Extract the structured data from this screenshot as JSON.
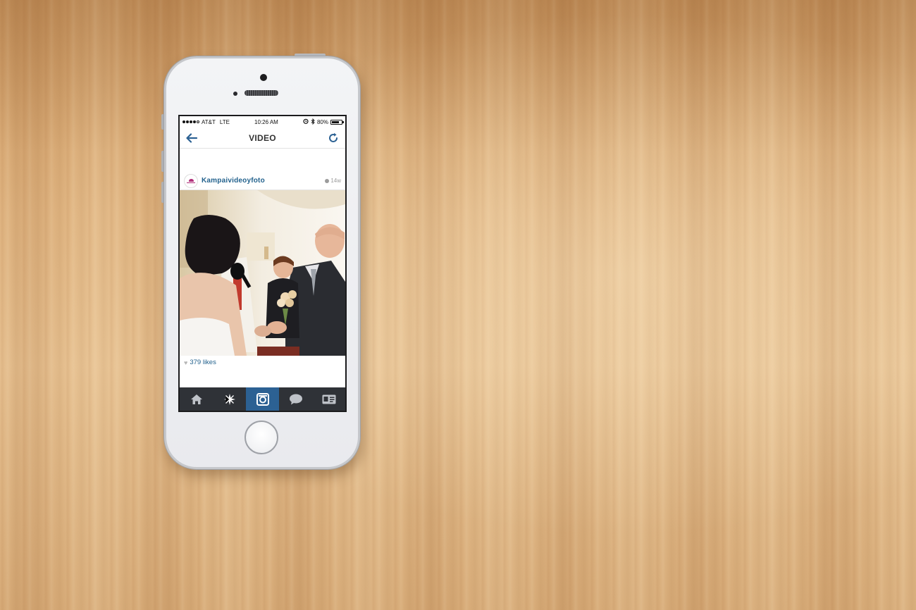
{
  "status_bar": {
    "carrier": "AT&T",
    "network": "LTE",
    "time": "10:26 AM",
    "battery": "80%",
    "battery_level": 0.8,
    "signal_bars": 4,
    "icons": [
      "alarm-icon",
      "bluetooth-icon",
      "battery-icon"
    ]
  },
  "nav": {
    "title": "VIDEO",
    "back_icon": "arrow-left-icon",
    "refresh_icon": "refresh-icon"
  },
  "post": {
    "username": "Kampaivideoyfoto",
    "time_ago": "14w",
    "likes": "379 likes"
  },
  "tab_bar": {
    "tabs": [
      {
        "icon": "home-icon",
        "active": false
      },
      {
        "icon": "explore-icon",
        "active": false
      },
      {
        "icon": "camera-icon",
        "active": true
      },
      {
        "icon": "news-icon",
        "active": false
      },
      {
        "icon": "profile-icon",
        "active": false
      }
    ]
  },
  "colors": {
    "accent": "#23628d",
    "tab_bar": "#2f3237",
    "active_tab": "#2c6193"
  }
}
